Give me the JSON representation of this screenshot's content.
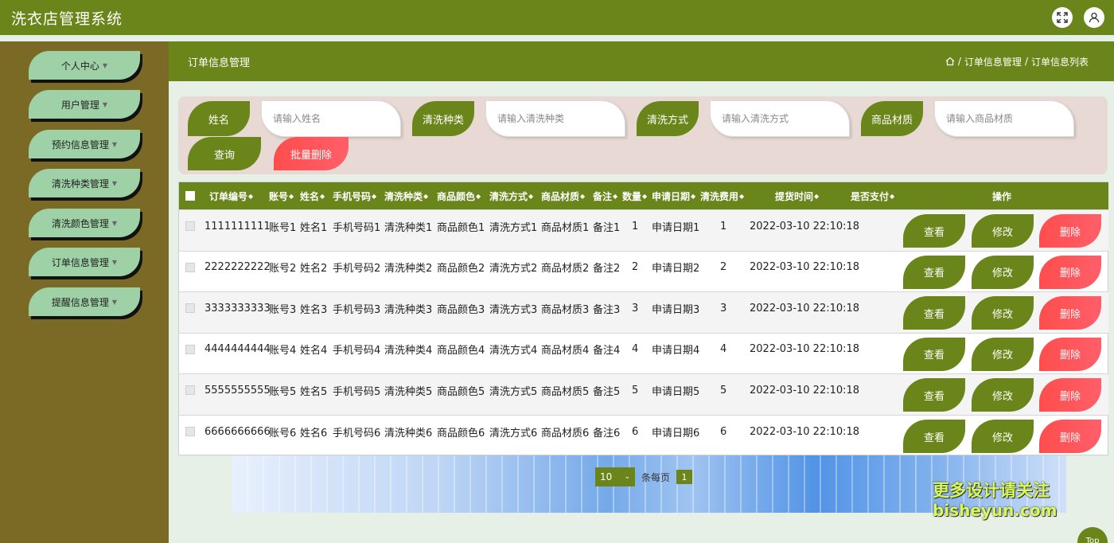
{
  "app": {
    "title": "洗衣店管理系统"
  },
  "header": {
    "fullscreen_icon": "expand-icon",
    "user_icon": "user-icon"
  },
  "sidebar": {
    "items": [
      {
        "label": "个人中心"
      },
      {
        "label": "用户管理"
      },
      {
        "label": "预约信息管理"
      },
      {
        "label": "清洗种类管理"
      },
      {
        "label": "清洗颜色管理"
      },
      {
        "label": "订单信息管理"
      },
      {
        "label": "提醒信息管理"
      }
    ]
  },
  "page": {
    "title": "订单信息管理",
    "breadcrumb": [
      "订单信息管理",
      "订单信息列表"
    ],
    "separator": "/"
  },
  "search": {
    "fields": [
      {
        "label": "姓名",
        "placeholder": "请输入姓名"
      },
      {
        "label": "清洗种类",
        "placeholder": "请输入清洗种类"
      },
      {
        "label": "清洗方式",
        "placeholder": "请输入清洗方式"
      },
      {
        "label": "商品材质",
        "placeholder": "请输入商品材质"
      }
    ],
    "query_label": "查询",
    "batch_delete_label": "批量删除"
  },
  "table": {
    "columns": [
      "订单编号",
      "账号",
      "姓名",
      "手机号码",
      "清洗种类",
      "商品颜色",
      "清洗方式",
      "商品材质",
      "备注",
      "数量",
      "申请日期",
      "清洗费用",
      "提货时间",
      "是否支付",
      "操作"
    ],
    "rows": [
      [
        "1111111111",
        "账号1",
        "姓名1",
        "手机号码1",
        "清洗种类1",
        "商品颜色1",
        "清洗方式1",
        "商品材质1",
        "备注1",
        "1",
        "申请日期1",
        "1",
        "2022-03-10 22:10:18",
        ""
      ],
      [
        "2222222222",
        "账号2",
        "姓名2",
        "手机号码2",
        "清洗种类2",
        "商品颜色2",
        "清洗方式2",
        "商品材质2",
        "备注2",
        "2",
        "申请日期2",
        "2",
        "2022-03-10 22:10:18",
        ""
      ],
      [
        "3333333333",
        "账号3",
        "姓名3",
        "手机号码3",
        "清洗种类3",
        "商品颜色3",
        "清洗方式3",
        "商品材质3",
        "备注3",
        "3",
        "申请日期3",
        "3",
        "2022-03-10 22:10:18",
        ""
      ],
      [
        "4444444444",
        "账号4",
        "姓名4",
        "手机号码4",
        "清洗种类4",
        "商品颜色4",
        "清洗方式4",
        "商品材质4",
        "备注4",
        "4",
        "申请日期4",
        "4",
        "2022-03-10 22:10:18",
        ""
      ],
      [
        "5555555555",
        "账号5",
        "姓名5",
        "手机号码5",
        "清洗种类5",
        "商品颜色5",
        "清洗方式5",
        "商品材质5",
        "备注5",
        "5",
        "申请日期5",
        "5",
        "2022-03-10 22:10:18",
        ""
      ],
      [
        "6666666666",
        "账号6",
        "姓名6",
        "手机号码6",
        "清洗种类6",
        "商品颜色6",
        "清洗方式6",
        "商品材质6",
        "备注6",
        "6",
        "申请日期6",
        "6",
        "2022-03-10 22:10:18",
        ""
      ]
    ],
    "actions": {
      "view": "查看",
      "edit": "修改",
      "delete": "删除"
    }
  },
  "pagination": {
    "page_size": "10",
    "per_page_label": "条每页",
    "current_page": "1"
  },
  "watermark": {
    "line1": "更多设计请关注",
    "line2": "bisheyun.com"
  },
  "back_to_top": "Top",
  "colors": {
    "primary": "#6a8519",
    "sidebar": "#7a6a25",
    "sidebar_item": "#9fd1a6",
    "danger": "#ff4d4d",
    "search_bg": "#e8d9d4"
  }
}
